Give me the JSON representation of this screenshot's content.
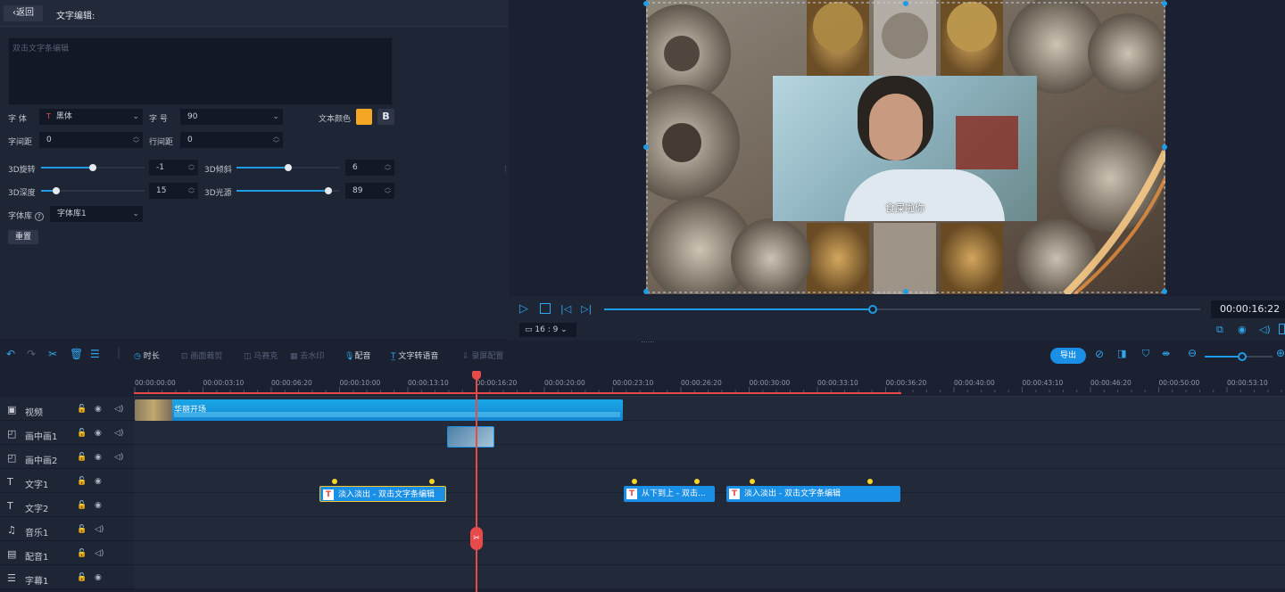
{
  "left_panel": {
    "back_label": "返回",
    "edit_title": "文字编辑:",
    "text_placeholder": "双击文字条编辑",
    "font_label": "字  体",
    "font_value": "黑体",
    "size_label": "字  号",
    "size_value": "90",
    "color_label": "文本颜色",
    "text_color": "#f5a623",
    "bold_label": "B",
    "char_spacing_label": "字间距",
    "char_spacing_value": "0",
    "line_spacing_label": "行间距",
    "line_spacing_value": "0",
    "rotate_label": "3D旋转",
    "rotate_value": "-1",
    "rotate_level": 0.5,
    "tilt_label": "3D倾斜",
    "tilt_value": "6",
    "tilt_level": 0.5,
    "depth_label": "3D深度",
    "depth_value": "15",
    "depth_level": 0.15,
    "light_label": "3D光源",
    "light_value": "89",
    "light_level": 0.89,
    "fontlib_label": "字体库",
    "fontlib_value": "字体库1",
    "reset_label": "重置"
  },
  "preview": {
    "subtitle_text": "食屎啦你",
    "progress": 0.45,
    "time": "00:00:16:22",
    "aspect": "16 : 9"
  },
  "toolbar": {
    "duration": "时长",
    "picture_crop": "画面裁剪",
    "mosaic": "马赛克",
    "watermark": "去水印",
    "dubbing": "配音",
    "tts": "文字转语音",
    "record": "录屏配置",
    "export": "导出"
  },
  "ruler": [
    "00:00:00:00",
    "00:00:03:10",
    "00:00:06:20",
    "00:00:10:00",
    "00:00:13:10",
    "00:00:16:20",
    "00:00:20:00",
    "00:00:23:10",
    "00:00:26:20",
    "00:00:30:00",
    "00:00:33:10",
    "00:00:36:20",
    "00:00:40:00",
    "00:00:43:10",
    "00:00:46:20",
    "00:00:50:00",
    "00:00:53:10"
  ],
  "tracks": [
    {
      "name": "视频",
      "icon": "video-icon"
    },
    {
      "name": "画中画1",
      "icon": "pip-icon"
    },
    {
      "name": "画中画2",
      "icon": "pip-icon"
    },
    {
      "name": "文字1",
      "icon": "text-icon"
    },
    {
      "name": "文字2",
      "icon": "text-icon"
    },
    {
      "name": "音乐1",
      "icon": "music-icon"
    },
    {
      "name": "配音1",
      "icon": "mic-icon"
    },
    {
      "name": "字幕1",
      "icon": "subtitle-icon"
    }
  ],
  "clips": {
    "video_clip": "华丽开场",
    "text_clip_1": "淡入淡出 - 双击文字条编辑",
    "text_clip_2": "从下到上 - 双击...",
    "text_clip_3": "淡入淡出 - 双击文字条编辑"
  },
  "colors": {
    "accent": "#1a8fe6",
    "playhead": "#e84a4a",
    "keyframe": "#f5d32a"
  }
}
